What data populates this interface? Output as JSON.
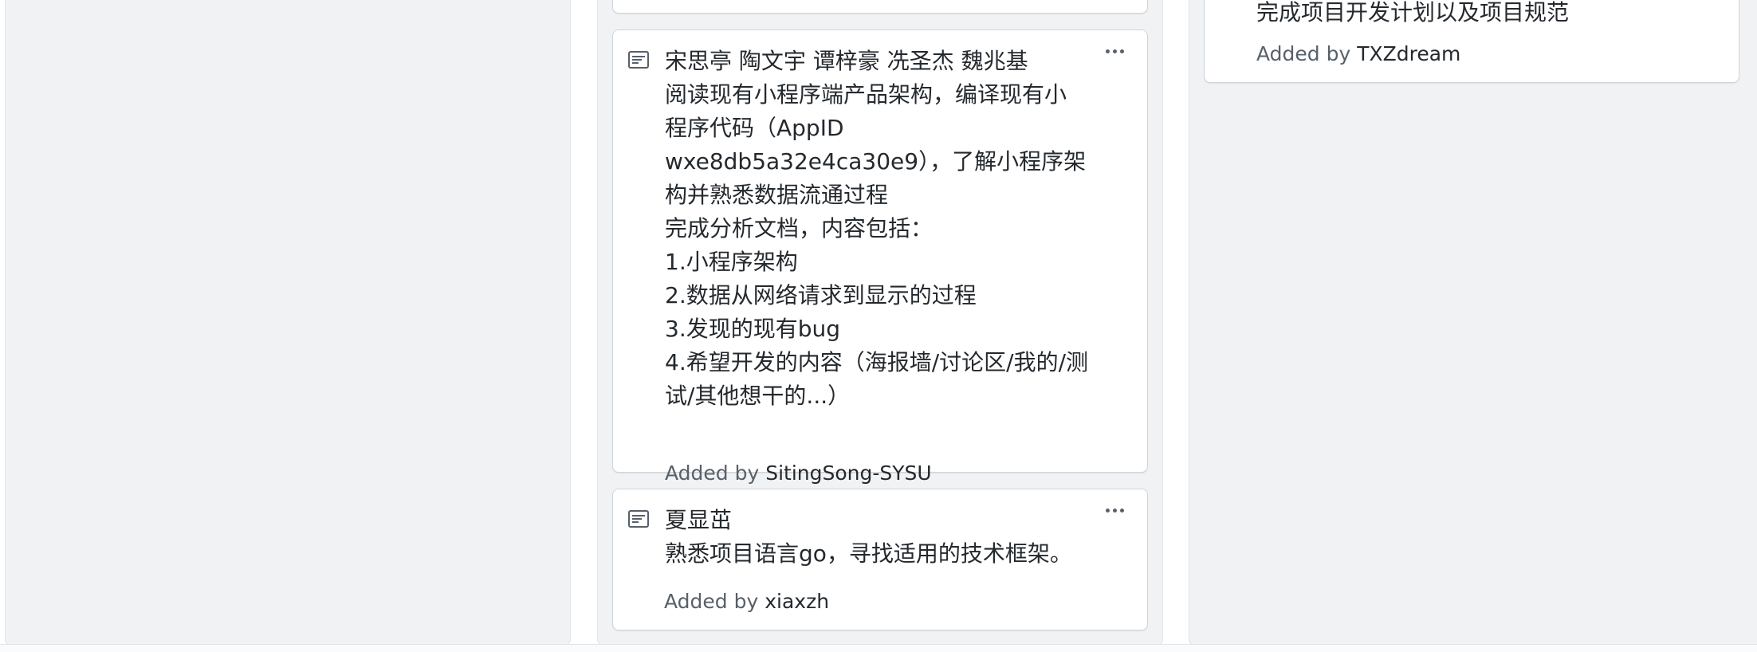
{
  "board": {
    "cards": {
      "a": {
        "body": "宋思亭 陶文宇 谭梓豪 冼圣杰 魏兆基\n阅读现有小程序端产品架构，编译现有小\n程序代码（AppID\nwxe8db5a32e4ca30e9），了解小程序架\n构并熟悉数据流通过程\n完成分析文档，内容包括：\n1.小程序架构\n2.数据从网络请求到显示的过程\n3.发现的现有bug\n4.希望开发的内容（海报墙/讨论区/我的/测\n试/其他想干的...）",
        "added_prefix": "Added by",
        "author": "SitingSong-SYSU"
      },
      "b": {
        "body": "夏显茁\n熟悉项目语言go，寻找适用的技术框架。",
        "added_prefix": "Added by",
        "author": "xiaxzh"
      },
      "right": {
        "body": "完成项目开发计划以及项目规范",
        "added_prefix": "Added by",
        "author": "TXZdream"
      }
    },
    "icons": {
      "note": "note-icon",
      "menu": "kebab-horizontal-icon"
    },
    "colors": {
      "column_bg": "#f1f2f4",
      "card_border": "#d1d5da",
      "muted_text": "#586069"
    }
  }
}
